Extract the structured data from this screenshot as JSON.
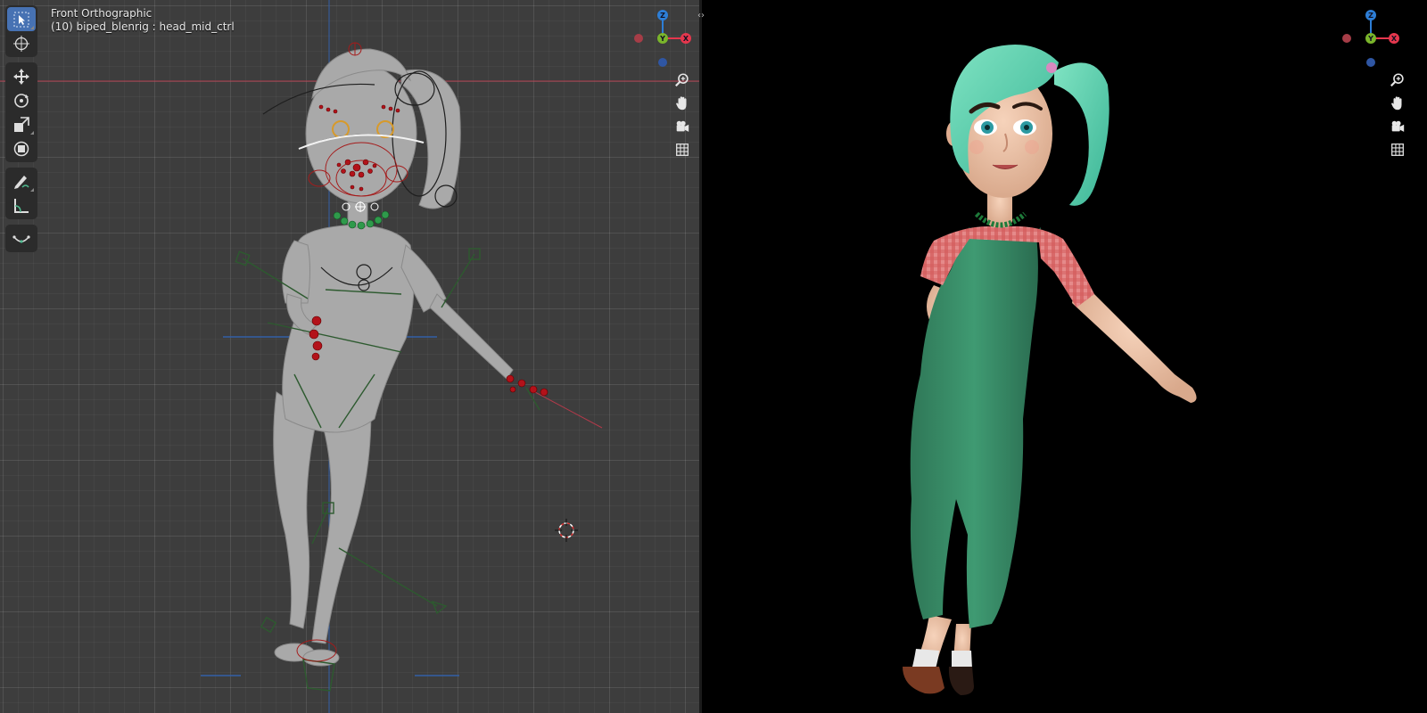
{
  "viewport_left": {
    "title": "Front Orthographic",
    "object_label": "(10) biped_blenrig : head_mid_ctrl"
  },
  "toolbar": {
    "tools": [
      {
        "name": "select-box",
        "icon": "select-cursor-icon",
        "active": true
      },
      {
        "name": "cursor",
        "icon": "3d-cursor-icon"
      },
      {
        "name": "move",
        "icon": "move-icon"
      },
      {
        "name": "rotate",
        "icon": "rotate-icon"
      },
      {
        "name": "scale",
        "icon": "scale-icon"
      },
      {
        "name": "transform",
        "icon": "transform-icon"
      },
      {
        "name": "annotate",
        "icon": "annotate-icon"
      },
      {
        "name": "measure",
        "icon": "measure-icon"
      },
      {
        "name": "pose",
        "icon": "pose-curve-icon"
      }
    ]
  },
  "navigation": {
    "buttons": [
      "zoom-icon",
      "pan-hand-icon",
      "camera-icon",
      "ortho-grid-icon"
    ]
  },
  "gizmo": {
    "axes": [
      "Z",
      "Y",
      "X"
    ],
    "colors": {
      "x": "#e5374d",
      "y": "#7ab52b",
      "z": "#2d7ed6",
      "neg_x": "#a63d47",
      "neg_z": "#2f56a3"
    }
  },
  "colors": {
    "viewport_bg": "#3d3d3d",
    "active_tool": "#4772b3",
    "overalls": "#3a8a62",
    "hair": "#5fcfae",
    "rig_red": "#c0141a"
  }
}
